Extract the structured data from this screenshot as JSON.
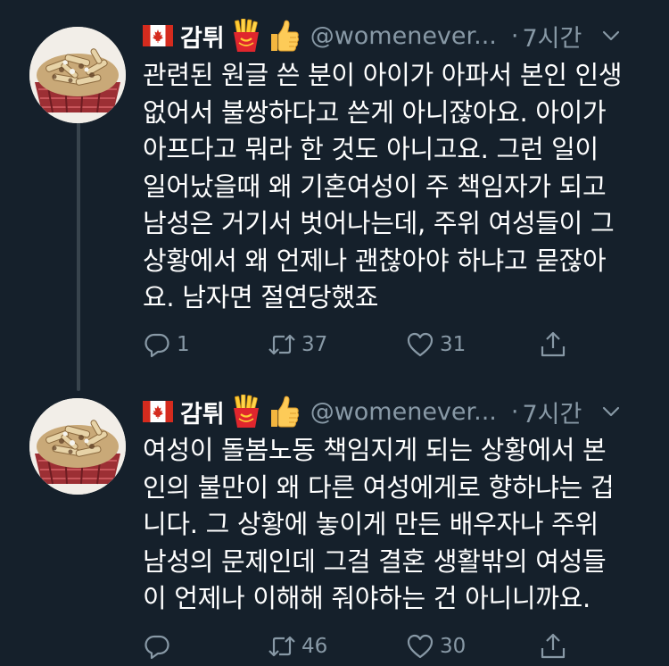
{
  "tweets": [
    {
      "name": "감튀",
      "handle": "@womenever...",
      "dot": "·",
      "time": "7시간",
      "text": "관련된 원글 쓴 분이 아이가 아파서 본인 인생\n없어서 불쌍하다고 쓴게 아니잖아요. 아이가\n아프다고 뭐라 한 것도 아니고요. 그런 일이\n일어났을때 왜 기혼여성이 주 책임자가 되고\n남성은 거기서 벗어나는데, 주위 여성들이 그\n상황에서 왜 언제나 괜찮아야 하냐고 묻잖아\n요. 남자면 절연당했죠",
      "reply_count": "1",
      "retweet_count": "37",
      "like_count": "31",
      "icons": [
        "canada-flag-icon",
        "french-fries-icon",
        "thumbs-up-icon",
        "chevron-down-icon",
        "reply-icon",
        "retweet-icon",
        "heart-icon",
        "share-icon"
      ]
    },
    {
      "name": "감튀",
      "handle": "@womenever...",
      "dot": "·",
      "time": "7시간",
      "text": "여성이 돌봄노동 책임지게 되는 상황에서 본\n인의 불만이 왜 다른 여성에게로 향하냐는 겁\n니다. 그 상황에 놓이게 만든 배우자나 주위\n남성의 문제인데 그걸 결혼 생활밖의 여성들\n이 언제나 이해해 줘야하는 건 아니니까요.",
      "reply_count": "",
      "retweet_count": "46",
      "like_count": "30",
      "icons": [
        "canada-flag-icon",
        "french-fries-icon",
        "thumbs-up-icon",
        "chevron-down-icon",
        "reply-icon",
        "retweet-icon",
        "heart-icon",
        "share-icon"
      ]
    }
  ],
  "colors": {
    "background": "#15202b",
    "text": "#ffffff",
    "secondary": "#8899a6",
    "thread_line": "#38444d"
  }
}
